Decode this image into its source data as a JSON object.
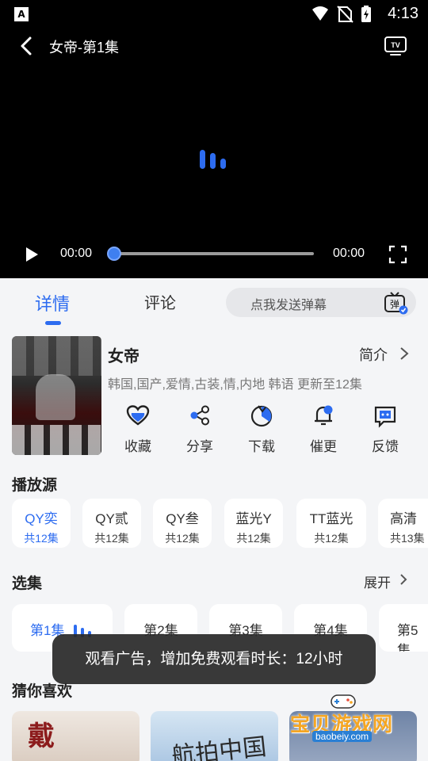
{
  "status_bar": {
    "time": "4:13",
    "app_icon": "A"
  },
  "player": {
    "title": "女帝-第1集",
    "current_time": "00:00",
    "duration": "00:00",
    "progress": 0
  },
  "tabs": [
    {
      "label": "详情",
      "active": true
    },
    {
      "label": "评论",
      "active": false
    }
  ],
  "danmu": {
    "placeholder": "点我发送弹幕",
    "icon_char": "弹"
  },
  "show": {
    "title": "女帝",
    "intro_label": "简介",
    "tags": "韩国,国产,爱情,古装,情,内地 韩语 更新至12集"
  },
  "actions": [
    {
      "label": "收藏",
      "icon": "heart-icon"
    },
    {
      "label": "分享",
      "icon": "share-icon"
    },
    {
      "label": "下载",
      "icon": "download-icon"
    },
    {
      "label": "催更",
      "icon": "bell-icon"
    },
    {
      "label": "反馈",
      "icon": "feedback-icon"
    }
  ],
  "sources": {
    "heading": "播放源",
    "items": [
      {
        "name": "QY奕",
        "count": "共12集",
        "active": true
      },
      {
        "name": "QY贰",
        "count": "共12集",
        "active": false
      },
      {
        "name": "QY叁",
        "count": "共12集",
        "active": false
      },
      {
        "name": "蓝光Y",
        "count": "共12集",
        "active": false
      },
      {
        "name": "TT蓝光",
        "count": "共12集",
        "active": false
      },
      {
        "name": "高清",
        "count": "共13集",
        "active": false
      }
    ]
  },
  "episodes": {
    "heading": "选集",
    "expand_label": "展开",
    "items": [
      {
        "label": "第1集",
        "active": true
      },
      {
        "label": "第2集",
        "active": false
      },
      {
        "label": "第3集",
        "active": false
      },
      {
        "label": "第4集",
        "active": false
      },
      {
        "label": "第5集",
        "active": false
      }
    ]
  },
  "toast": "观看广告，增加免费观看时长：12小时",
  "recommend": {
    "heading": "猜你喜欢",
    "items": [
      {
        "poster_text": "戴"
      },
      {
        "poster_text": "航拍中国"
      },
      {
        "poster_text": ""
      }
    ]
  },
  "watermark": {
    "title": "宝贝游戏网",
    "url": "baobeiy.com"
  },
  "colors": {
    "accent": "#2d6cf0",
    "background": "#f4f5f7",
    "player_bg": "#000000"
  }
}
